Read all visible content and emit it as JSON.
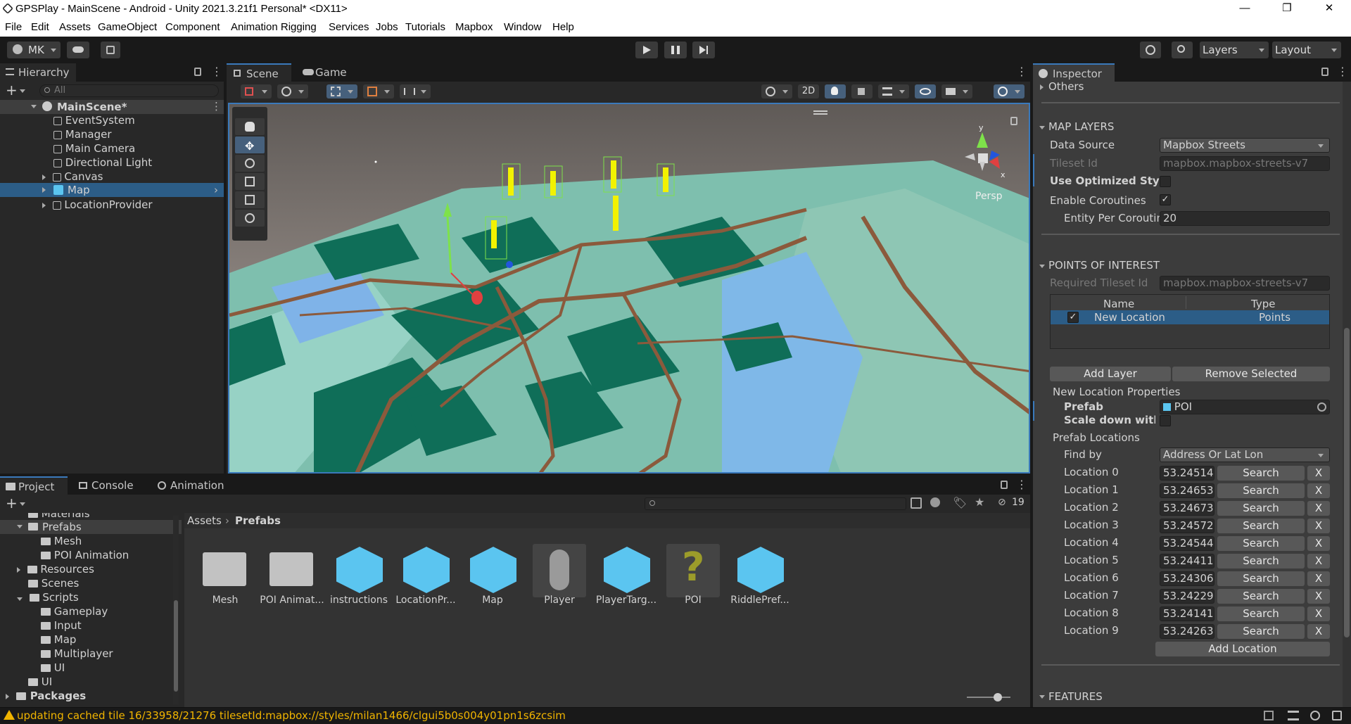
{
  "window": {
    "title": "GPSPlay - MainScene - Android - Unity 2021.3.21f1 Personal* <DX11>",
    "minimize": "—",
    "maximize": "❐",
    "close": "✕"
  },
  "menu": [
    "File",
    "Edit",
    "Assets",
    "GameObject",
    "Component",
    "Animation Rigging",
    "Services",
    "Jobs",
    "Tutorials",
    "Mapbox",
    "Window",
    "Help"
  ],
  "toolbar": {
    "account": "MK",
    "layers": "Layers",
    "layout": "Layout"
  },
  "hierarchy": {
    "tab": "Hierarchy",
    "search_placeholder": "All",
    "scene": "MainScene*",
    "items": [
      "EventSystem",
      "Manager",
      "Main Camera",
      "Directional Light",
      "Canvas",
      "Map",
      "LocationProvider"
    ]
  },
  "scene_view": {
    "tabs": [
      "Scene",
      "Game"
    ],
    "mode_2d": "2D",
    "persp": "Persp",
    "gizmo_x": "x",
    "gizmo_y": "y"
  },
  "project": {
    "tabs": [
      "Project",
      "Console",
      "Animation"
    ],
    "count": "19",
    "breadcrumb": [
      "Assets",
      "Prefabs"
    ],
    "tree": [
      {
        "label": "Materials"
      },
      {
        "label": "Prefabs"
      },
      {
        "label": "Mesh"
      },
      {
        "label": "POI Animation"
      },
      {
        "label": "Resources"
      },
      {
        "label": "Scenes"
      },
      {
        "label": "Scripts"
      },
      {
        "label": "Gameplay"
      },
      {
        "label": "Input"
      },
      {
        "label": "Map"
      },
      {
        "label": "Multiplayer"
      },
      {
        "label": "UI"
      },
      {
        "label": "UI"
      },
      {
        "label": "Packages"
      }
    ],
    "assets": [
      "Mesh",
      "POI Animat...",
      "instructions",
      "LocationPr...",
      "Map",
      "Player",
      "PlayerTarg...",
      "POI",
      "RiddlePref..."
    ]
  },
  "inspector": {
    "tab": "Inspector",
    "others": "Others",
    "map_layers": "MAP LAYERS",
    "data_source_label": "Data Source",
    "data_source": "Mapbox Streets",
    "tileset_label": "Tileset Id",
    "tileset": "mapbox.mapbox-streets-v7",
    "optimized_label": "Use Optimized Style",
    "coroutines_label": "Enable Coroutines",
    "coroutines_check": "✓",
    "entity_label": "Entity Per Coroutin",
    "entity_value": "20",
    "poi_header": "POINTS OF INTEREST",
    "req_tileset_label": "Required Tileset Id",
    "req_tileset": "mapbox.mapbox-streets-v7",
    "col_name": "Name",
    "col_type": "Type",
    "layer_check": "✓",
    "layer_name": "New Location",
    "layer_type": "Points",
    "add_layer": "Add Layer",
    "remove_selected": "Remove Selected",
    "props_title": "New Location Properties",
    "prefab_label": "Prefab",
    "prefab_value": "POI",
    "scale_label": "Scale down with w",
    "prefab_locations": "Prefab Locations",
    "find_by_label": "Find by",
    "find_by": "Address Or Lat Lon",
    "locations": [
      {
        "label": "Location 0",
        "value": "53.24514"
      },
      {
        "label": "Location 1",
        "value": "53.24653"
      },
      {
        "label": "Location 2",
        "value": "53.24673"
      },
      {
        "label": "Location 3",
        "value": "53.24572"
      },
      {
        "label": "Location 4",
        "value": "53.24544"
      },
      {
        "label": "Location 5",
        "value": "53.24411"
      },
      {
        "label": "Location 6",
        "value": "53.24306"
      },
      {
        "label": "Location 7",
        "value": "53.24229"
      },
      {
        "label": "Location 8",
        "value": "53.24141"
      },
      {
        "label": "Location 9",
        "value": "53.24263"
      }
    ],
    "search": "Search",
    "remove_x": "X",
    "add_location": "Add Location",
    "features": "FEATURES"
  },
  "status": {
    "text": "updating cached tile 16/33958/21276 tilesetId:mapbox://styles/milan1466/clgui5b0s004y01pn1s6zcsim"
  },
  "colors": {
    "accent": "#3a79bb",
    "selection": "#2c5d87",
    "map_green": "#0f6e58",
    "map_water": "#7fb3e8",
    "road": "#8b5a3c",
    "poi_yellow": "#f2f200"
  }
}
